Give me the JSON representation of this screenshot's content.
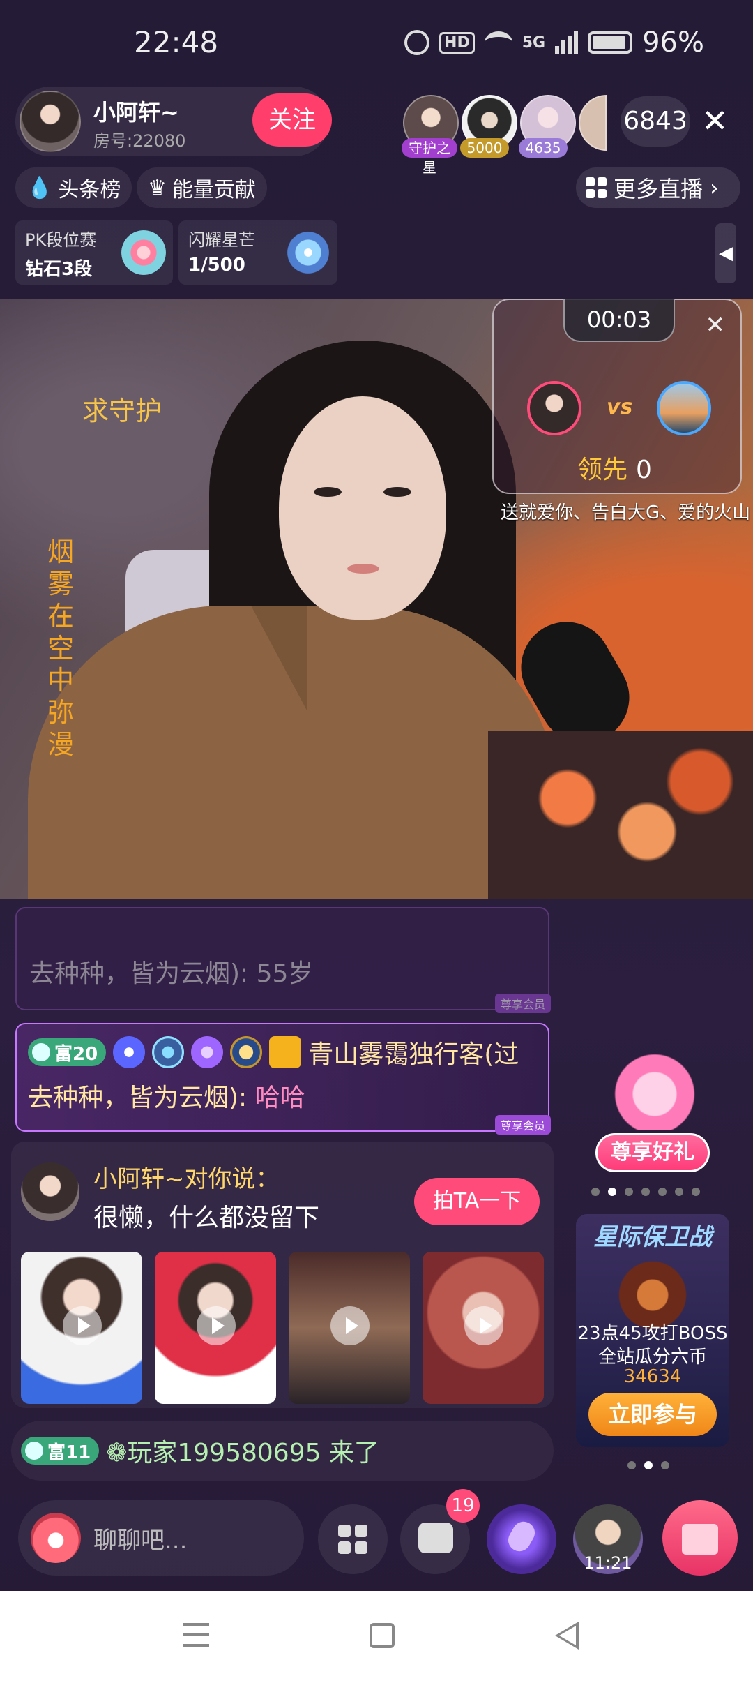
{
  "status_bar": {
    "time": "22:48",
    "hd": "HD",
    "network": "5G",
    "battery": "96%"
  },
  "header": {
    "host_name": "小阿轩~",
    "room": "房号:22080",
    "follow_label": "关注",
    "viewer_badges": [
      "守护之星",
      "5000",
      "4635"
    ],
    "viewer_count": "6843",
    "close_label": "✕"
  },
  "chips": {
    "headline_label": "头条榜",
    "energy_label": "能量贡献",
    "more_live_label": "更多直播"
  },
  "cards": {
    "pk_title": "PK段位赛",
    "pk_value": "钻石3段",
    "star_title": "闪耀星芒",
    "star_value": "1/500"
  },
  "video": {
    "guard_text": "求守护",
    "vertical_text": "烟雾在空中弥漫"
  },
  "pk": {
    "timer": "00:03",
    "vs": "vs",
    "lead_label": "领先",
    "score": "0",
    "subtitle": "送就爱你、告白大G、爱的火山"
  },
  "chat": {
    "faded_text": "去种种，皆为云烟): 55岁",
    "rich_level": "富20",
    "user_name": "青山雾霭独行客(过",
    "line2_prefix": "去种种，皆为云烟): ",
    "message": "哈哈",
    "member_tag": "尊享会员"
  },
  "message_card": {
    "title": "小阿轩~对你说：",
    "body": "很懒，什么都没留下",
    "pat_label": "拍TA一下"
  },
  "join": {
    "rich_level": "富11",
    "text": "❁玩家199580695 来了"
  },
  "promos": {
    "gift_label": "尊享好礼",
    "event_title": "星际保卫战",
    "event_line1": "23点45攻打BOSS",
    "event_line2": "全站瓜分六币",
    "event_number": "34634",
    "join_label": "立即参与"
  },
  "bottom": {
    "chat_placeholder": "聊聊吧...",
    "notif_count": "19",
    "avatar_time": "11:21"
  },
  "colors": {
    "accent": "#ff3e6c",
    "gold": "#ffd66b",
    "purple": "#c778ff"
  }
}
